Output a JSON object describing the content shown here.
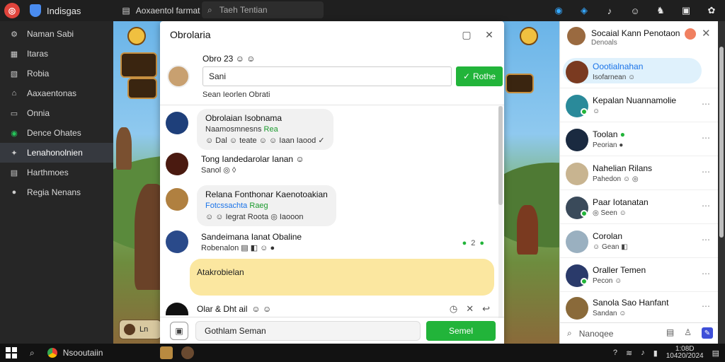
{
  "topbar": {
    "app_name": "Indisgas",
    "breadcrumb": "Aoxaentol farmat",
    "search_placeholder": "Taeh Tentian",
    "icons": [
      "messenger-icon",
      "shield-icon",
      "bell-icon",
      "emoji-icon",
      "avatar-icon",
      "menu-icon",
      "settings-icon"
    ]
  },
  "sidebar": {
    "items": [
      {
        "label": "Naman Sabi",
        "icon": "gear-icon"
      },
      {
        "label": "Itaras",
        "icon": "bag-icon"
      },
      {
        "label": "Robia",
        "icon": "photo-icon"
      },
      {
        "label": "Aaxaentonas",
        "icon": "home-icon"
      },
      {
        "label": "Onnia",
        "icon": "chat-icon"
      },
      {
        "label": "Dence Ohates",
        "icon": "whatsapp-icon"
      },
      {
        "label": "Lenahonolnien",
        "icon": "users-icon"
      },
      {
        "label": "Harthmoes",
        "icon": "card-icon"
      },
      {
        "label": "Regia Nenans",
        "icon": "globe-icon"
      }
    ]
  },
  "chat": {
    "title": "Obrolaria",
    "composer": {
      "name": "Obro 23",
      "input_value": "Sani",
      "send_label": "Rothe",
      "hint": "Sean Ieorlen Obrati"
    },
    "messages": [
      {
        "name": "Obrolaian Isobnama",
        "line1_prefix": "Naamosmnesns",
        "line1_tag": "Rea",
        "line2": "Dal",
        "line2_mid": "teate",
        "line2_end": "Iaan Iaood"
      },
      {
        "name": "Tong Iandedarolar Ianan",
        "line1": "Sanol"
      },
      {
        "name": "Relana Fonthonar Kaenotoakian",
        "line1_prefix": "Fotcssachta",
        "line1_tag": "Raeg",
        "line2": "Iegrat Roota",
        "line2_end": "Iaooon"
      },
      {
        "name": "Sandeimana Ianat Obaline",
        "line1": "Robenalon",
        "tail": "2"
      }
    ],
    "highlight_text": "Atakrobielan",
    "last_message_name": "Olar & Dht ail",
    "footer_placeholder": "Gothlam Seman",
    "footer_send": "Semel"
  },
  "contacts": {
    "title": "Socaial Kann Penotaon",
    "subtitle": "Denoals",
    "items": [
      {
        "name": "Oootialnahan",
        "status": "Isofarnean",
        "name_color": "#1a73e8",
        "avatar": "#7a3a20"
      },
      {
        "name": "Kepalan Nuannamolie",
        "status": "",
        "avatar": "#2a8a9a"
      },
      {
        "name": "Toolan",
        "status": "Peorian",
        "avatar": "#1a2a40"
      },
      {
        "name": "Nahelian Rilans",
        "status": "Pahedon",
        "avatar": "#c8b490"
      },
      {
        "name": "Paar Iotanatan",
        "status": "Seen",
        "avatar": "#3a4a5a"
      },
      {
        "name": "Corolan",
        "status": "Gean",
        "avatar": "#9ab0c0"
      },
      {
        "name": "Oraller Temen",
        "status": "Pecon",
        "avatar": "#2a3a6a"
      },
      {
        "name": "Sanola Sao Hanfant",
        "status": "Sandan",
        "avatar": "#8a6a3a"
      }
    ],
    "footer_search": "Nanoqee"
  },
  "taskbar": {
    "app_label": "Nsooutaiin",
    "clock_time": "1:08D",
    "clock_date": "10420/2024"
  }
}
